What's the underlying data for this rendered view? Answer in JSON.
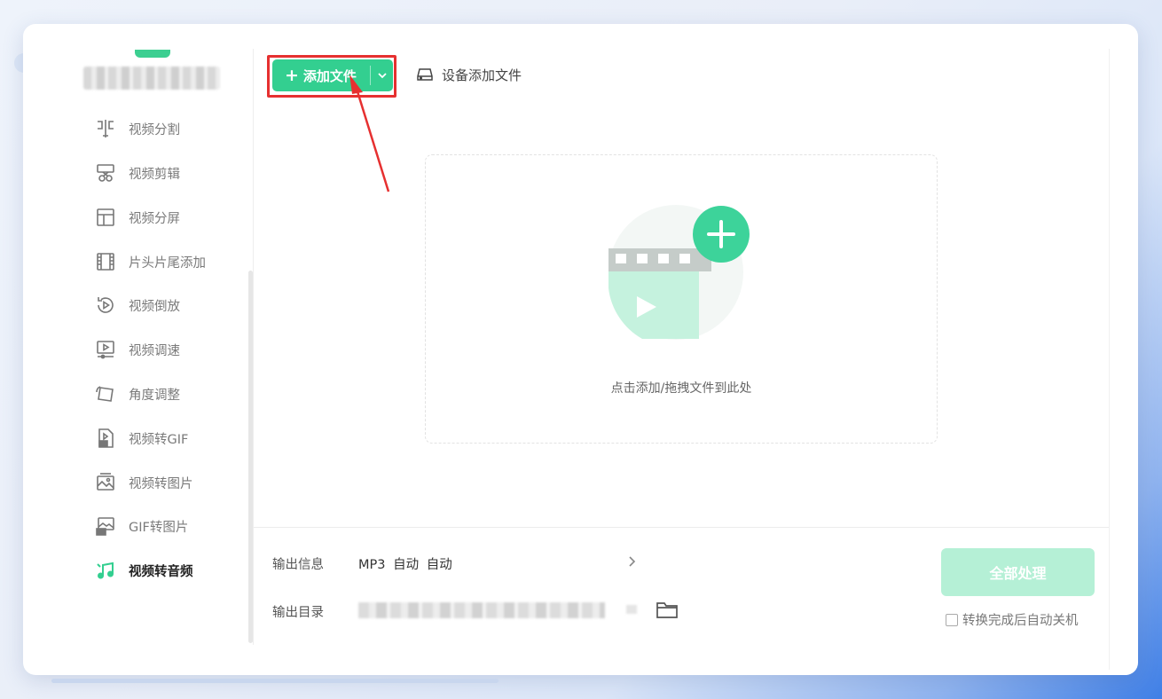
{
  "toolbar": {
    "add_file_label": "添加文件",
    "add_file_plus": "+",
    "device_add_label": "设备添加文件"
  },
  "sidebar": {
    "items": [
      {
        "label": "视频分割",
        "icon": "split-icon"
      },
      {
        "label": "视频剪辑",
        "icon": "scissors-icon"
      },
      {
        "label": "视频分屏",
        "icon": "layout-icon"
      },
      {
        "label": "片头片尾添加",
        "icon": "film-icon"
      },
      {
        "label": "视频倒放",
        "icon": "reverse-play-icon"
      },
      {
        "label": "视频调速",
        "icon": "speed-icon"
      },
      {
        "label": "角度调整",
        "icon": "rotate-icon"
      },
      {
        "label": "视频转GIF",
        "icon": "gif-file-icon"
      },
      {
        "label": "视频转图片",
        "icon": "image-icon"
      },
      {
        "label": "GIF转图片",
        "icon": "gif-image-icon"
      },
      {
        "label": "视频转音频",
        "icon": "music-icon",
        "active": true
      }
    ]
  },
  "dropzone": {
    "hint": "点击添加/拖拽文件到此处"
  },
  "output": {
    "info_label": "输出信息",
    "info_value": "MP3 自动 自动",
    "dir_label": "输出目录"
  },
  "actions": {
    "process_all_label": "全部处理",
    "auto_shutdown_label": "转换完成后自动关机",
    "auto_shutdown_checked": false
  },
  "colors": {
    "accent": "#33cf90",
    "accent_disabled": "#b5f0d6",
    "highlight_frame": "#e63030"
  }
}
